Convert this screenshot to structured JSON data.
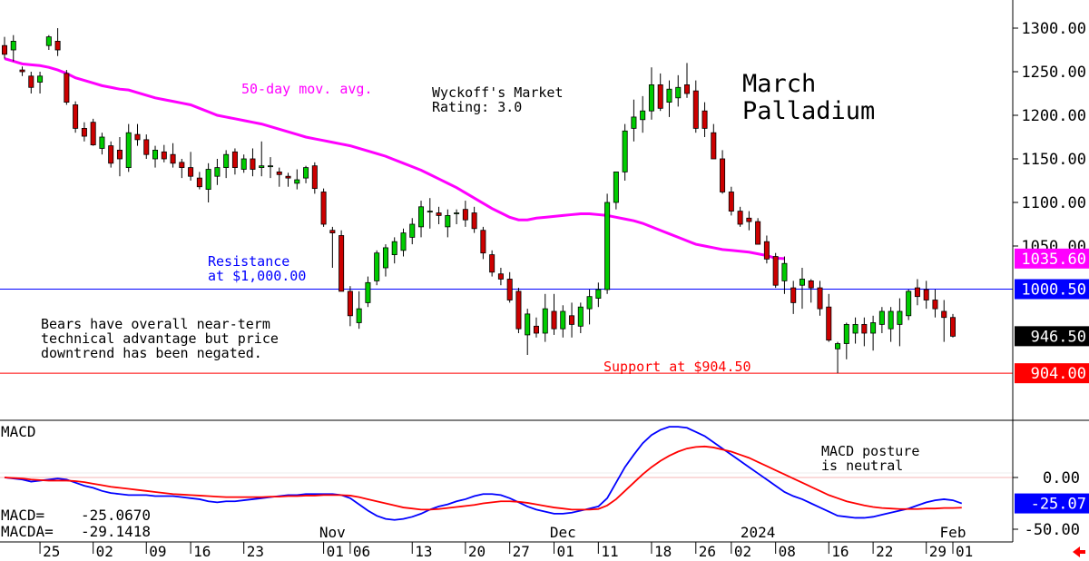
{
  "chart_data": [
    {
      "type": "candlestick",
      "title": "March\nPalladium",
      "ylim": [
        880,
        1320
      ],
      "yticks": [
        1300,
        1250,
        1200,
        1150,
        1100,
        1050
      ],
      "ytick_labels": [
        "1300.00",
        "1250.00",
        "1200.00",
        "1150.00",
        "1100.00",
        "1050.00"
      ],
      "colors": {
        "up": "#00cc00",
        "down": "#cc0000",
        "ma": "#ff00ff",
        "resistance": "#0000ff",
        "support": "#ff0000",
        "macd": "#0000ff",
        "macda": "#ff0000"
      },
      "ohlc": [
        [
          1280,
          1290,
          1265,
          1270
        ],
        [
          1275,
          1292,
          1262,
          1285
        ],
        [
          1252,
          1256,
          1245,
          1250
        ],
        [
          1245,
          1250,
          1225,
          1232
        ],
        [
          1238,
          1250,
          1225,
          1245
        ],
        [
          1280,
          1292,
          1275,
          1290
        ],
        [
          1285,
          1300,
          1268,
          1275
        ],
        [
          1248,
          1252,
          1212,
          1215
        ],
        [
          1212,
          1216,
          1180,
          1185
        ],
        [
          1185,
          1192,
          1170,
          1176
        ],
        [
          1192,
          1196,
          1165,
          1166
        ],
        [
          1162,
          1180,
          1155,
          1175
        ],
        [
          1165,
          1170,
          1140,
          1145
        ],
        [
          1160,
          1175,
          1130,
          1150
        ],
        [
          1140,
          1190,
          1135,
          1180
        ],
        [
          1178,
          1190,
          1165,
          1172
        ],
        [
          1172,
          1178,
          1150,
          1155
        ],
        [
          1150,
          1165,
          1140,
          1160
        ],
        [
          1158,
          1166,
          1146,
          1150
        ],
        [
          1155,
          1168,
          1140,
          1145
        ],
        [
          1146,
          1150,
          1128,
          1140
        ],
        [
          1140,
          1158,
          1125,
          1130
        ],
        [
          1128,
          1135,
          1115,
          1118
        ],
        [
          1115,
          1145,
          1100,
          1138
        ],
        [
          1130,
          1150,
          1120,
          1140
        ],
        [
          1140,
          1160,
          1128,
          1155
        ],
        [
          1158,
          1162,
          1132,
          1140
        ],
        [
          1138,
          1155,
          1134,
          1150
        ],
        [
          1150,
          1162,
          1130,
          1138
        ],
        [
          1140,
          1170,
          1130,
          1142
        ],
        [
          1142,
          1152,
          1128,
          1142
        ],
        [
          1135,
          1140,
          1118,
          1132
        ],
        [
          1130,
          1134,
          1118,
          1128
        ],
        [
          1122,
          1138,
          1115,
          1126
        ],
        [
          1128,
          1142,
          1122,
          1140
        ],
        [
          1142,
          1146,
          1110,
          1116
        ],
        [
          1112,
          1116,
          1072,
          1075
        ],
        [
          1068,
          1072,
          1025,
          1065
        ],
        [
          1062,
          1068,
          1000,
          998
        ],
        [
          998,
          1004,
          958,
          970
        ],
        [
          962,
          998,
          955,
          978
        ],
        [
          985,
          1015,
          980,
          1008
        ],
        [
          1010,
          1045,
          1005,
          1042
        ],
        [
          1025,
          1052,
          1015,
          1048
        ],
        [
          1040,
          1060,
          1030,
          1055
        ],
        [
          1045,
          1070,
          1038,
          1065
        ],
        [
          1060,
          1082,
          1052,
          1075
        ],
        [
          1072,
          1102,
          1060,
          1095
        ],
        [
          1090,
          1105,
          1070,
          1090
        ],
        [
          1088,
          1095,
          1075,
          1085
        ],
        [
          1072,
          1092,
          1060,
          1085
        ],
        [
          1088,
          1092,
          1075,
          1088
        ],
        [
          1092,
          1102,
          1072,
          1080
        ],
        [
          1088,
          1095,
          1065,
          1070
        ],
        [
          1068,
          1072,
          1035,
          1042
        ],
        [
          1040,
          1045,
          1015,
          1020
        ],
        [
          1018,
          1025,
          1005,
          1012
        ],
        [
          1012,
          1020,
          985,
          988
        ],
        [
          998,
          1002,
          950,
          955
        ],
        [
          948,
          978,
          925,
          972
        ],
        [
          958,
          968,
          945,
          950
        ],
        [
          950,
          995,
          940,
          978
        ],
        [
          975,
          995,
          948,
          955
        ],
        [
          955,
          982,
          945,
          975
        ],
        [
          970,
          985,
          945,
          960
        ],
        [
          958,
          985,
          950,
          980
        ],
        [
          978,
          1000,
          960,
          992
        ],
        [
          990,
          1008,
          980,
          1000
        ],
        [
          1000,
          1110,
          995,
          1100
        ],
        [
          1100,
          1135,
          1092,
          1135
        ],
        [
          1135,
          1190,
          1125,
          1182
        ],
        [
          1185,
          1218,
          1170,
          1198
        ],
        [
          1195,
          1222,
          1180,
          1205
        ],
        [
          1205,
          1255,
          1195,
          1235
        ],
        [
          1235,
          1248,
          1205,
          1208
        ],
        [
          1215,
          1240,
          1198,
          1230
        ],
        [
          1220,
          1246,
          1210,
          1232
        ],
        [
          1235,
          1260,
          1220,
          1225
        ],
        [
          1228,
          1240,
          1180,
          1185
        ],
        [
          1205,
          1215,
          1175,
          1185
        ],
        [
          1180,
          1190,
          1155,
          1150
        ],
        [
          1150,
          1160,
          1110,
          1112
        ],
        [
          1112,
          1118,
          1085,
          1090
        ],
        [
          1090,
          1095,
          1072,
          1075
        ],
        [
          1082,
          1090,
          1068,
          1078
        ],
        [
          1078,
          1082,
          1052,
          1052
        ],
        [
          1055,
          1062,
          1030,
          1035
        ],
        [
          1038,
          1042,
          1002,
          1005
        ],
        [
          1010,
          1038,
          995,
          1030
        ],
        [
          1002,
          1010,
          972,
          985
        ],
        [
          1005,
          1025,
          978,
          1012
        ],
        [
          1010,
          1012,
          985,
          1002
        ],
        [
          1002,
          1010,
          970,
          978
        ],
        [
          980,
          995,
          940,
          942
        ],
        [
          932,
          940,
          904,
          938
        ],
        [
          938,
          962,
          920,
          960
        ],
        [
          950,
          968,
          938,
          960
        ],
        [
          960,
          968,
          935,
          950
        ],
        [
          950,
          970,
          930,
          962
        ],
        [
          960,
          980,
          950,
          975
        ],
        [
          955,
          980,
          940,
          975
        ],
        [
          960,
          990,
          935,
          975
        ],
        [
          970,
          1000,
          965,
          998
        ],
        [
          1002,
          1012,
          982,
          992
        ],
        [
          1000,
          1010,
          978,
          988
        ],
        [
          988,
          1000,
          968,
          978
        ],
        [
          975,
          988,
          940,
          968
        ],
        [
          968,
          972,
          945,
          946.5
        ]
      ],
      "ma_50": [
        1265,
        1262,
        1259,
        1258,
        1257,
        1255,
        1252,
        1248,
        1243,
        1240,
        1237,
        1234,
        1232,
        1230,
        1229,
        1226,
        1223,
        1220,
        1218,
        1216,
        1214,
        1212,
        1208,
        1204,
        1200,
        1198,
        1196,
        1194,
        1192,
        1190,
        1187,
        1184,
        1181,
        1178,
        1175,
        1173,
        1171,
        1169,
        1167,
        1165,
        1162,
        1159,
        1156,
        1153,
        1149,
        1145,
        1141,
        1137,
        1132,
        1127,
        1122,
        1117,
        1111,
        1105,
        1099,
        1093,
        1088,
        1083,
        1080,
        1080,
        1082,
        1083,
        1084,
        1085,
        1086,
        1087,
        1087,
        1086,
        1085,
        1083,
        1081,
        1079,
        1076,
        1072,
        1068,
        1064,
        1060,
        1056,
        1052,
        1050,
        1048,
        1046,
        1045,
        1044,
        1043,
        1041,
        1039,
        1036,
        1035.6
      ],
      "resistance": {
        "value": 1000.5,
        "label": "Resistance\nat $1,000.00"
      },
      "support": {
        "value": 904,
        "label": "Support at $904.50"
      },
      "price_labels": [
        {
          "value": 1035.6,
          "text": "1035.60",
          "bg": "#ff00ff"
        },
        {
          "value": 1000.5,
          "text": "1000.50",
          "bg": "#0000ff"
        },
        {
          "value": 946.5,
          "text": "946.50",
          "bg": "#000000"
        },
        {
          "value": 904,
          "text": "904.00",
          "bg": "#ff0000"
        }
      ],
      "annotations": [
        {
          "id": "ma-label",
          "text": "50-day mov. avg.",
          "color": "#ff00ff"
        },
        {
          "id": "wyckoff-rating",
          "text": "Wyckoff's Market\nRating: 3.0",
          "color": "#000000"
        },
        {
          "id": "bears-note",
          "text": "Bears have overall near-term\ntechnical advantage but price\ndowntrend has been negated.",
          "color": "#000000"
        }
      ],
      "x_ticks": [
        {
          "i": 4,
          "label": "25"
        },
        {
          "i": 10,
          "label": "02"
        },
        {
          "i": 16,
          "label": "09"
        },
        {
          "i": 21,
          "label": "16"
        },
        {
          "i": 27,
          "label": "23"
        },
        {
          "i": 36,
          "label": "01"
        },
        {
          "i": 39,
          "label": "06"
        },
        {
          "i": 46,
          "label": "13"
        },
        {
          "i": 52,
          "label": "20"
        },
        {
          "i": 57,
          "label": "27"
        },
        {
          "i": 62,
          "label": "01"
        },
        {
          "i": 67,
          "label": "11"
        },
        {
          "i": 73,
          "label": "18"
        },
        {
          "i": 78,
          "label": "26"
        },
        {
          "i": 82,
          "label": "02"
        },
        {
          "i": 87,
          "label": "08"
        },
        {
          "i": 93,
          "label": "16"
        },
        {
          "i": 98,
          "label": "22"
        },
        {
          "i": 104,
          "label": "29"
        },
        {
          "i": 107,
          "label": "01"
        }
      ],
      "month_labels": [
        {
          "i": 37,
          "label": "Nov"
        },
        {
          "i": 63,
          "label": "Dec"
        },
        {
          "i": 85,
          "label": "2024"
        },
        {
          "i": 107,
          "label": "Feb"
        }
      ]
    },
    {
      "type": "line",
      "title": "MACD",
      "ylim": [
        -60,
        30
      ],
      "yticks": [
        0,
        -50
      ],
      "ytick_labels": [
        "0.00",
        "-50.00"
      ],
      "series": [
        {
          "name": "MACD",
          "color": "#0000ff",
          "values": [
            0,
            -1,
            -2,
            -4,
            -3,
            -2,
            -1,
            -2,
            -5,
            -8,
            -10,
            -13,
            -15,
            -16,
            -17,
            -17,
            -17,
            -18,
            -18,
            -18,
            -19,
            -20,
            -21,
            -23,
            -24,
            -23,
            -23,
            -22,
            -21,
            -20,
            -19,
            -18,
            -17,
            -17,
            -16,
            -16,
            -16,
            -16,
            -17,
            -20,
            -26,
            -32,
            -37,
            -40,
            -41,
            -40,
            -38,
            -35,
            -31,
            -28,
            -26,
            -23,
            -21,
            -18,
            -16,
            -16,
            -17,
            -20,
            -24,
            -28,
            -31,
            -33,
            -35,
            -35,
            -34,
            -32,
            -30,
            -28,
            -20,
            -5,
            10,
            22,
            33,
            41,
            46,
            49,
            49,
            48,
            44,
            40,
            34,
            28,
            22,
            16,
            10,
            4,
            -2,
            -8,
            -14,
            -18,
            -21,
            -25,
            -29,
            -33,
            -37,
            -38,
            -39,
            -39,
            -38,
            -36,
            -34,
            -32,
            -30,
            -27,
            -24,
            -22,
            -21,
            -22,
            -25.07
          ]
        },
        {
          "name": "MACDA",
          "color": "#ff0000",
          "values": [
            0,
            -0.5,
            -1,
            -2,
            -2.5,
            -3,
            -3,
            -3,
            -3.5,
            -4.5,
            -6,
            -7.5,
            -9,
            -10,
            -11,
            -12,
            -13,
            -14,
            -15,
            -16,
            -16.5,
            -17,
            -17.5,
            -18,
            -18.5,
            -19,
            -19,
            -19,
            -19,
            -19,
            -18.5,
            -18.5,
            -18,
            -18,
            -17.5,
            -17.5,
            -17,
            -17,
            -17,
            -17.5,
            -19,
            -21,
            -23,
            -25,
            -27,
            -29,
            -30,
            -31,
            -31,
            -30.5,
            -29.5,
            -28.5,
            -27.5,
            -26.5,
            -25,
            -24,
            -23,
            -23,
            -23.5,
            -24.5,
            -26,
            -27.5,
            -29,
            -30,
            -31,
            -31,
            -31,
            -30.5,
            -27,
            -21,
            -13,
            -5,
            3,
            10,
            16,
            21,
            25,
            28,
            29.5,
            30,
            29,
            27,
            25,
            22,
            19,
            15,
            11,
            7,
            3,
            -1,
            -5,
            -9,
            -13,
            -17,
            -20,
            -23,
            -25,
            -27,
            -28.5,
            -29.5,
            -30,
            -30.5,
            -30.5,
            -30.5,
            -30,
            -30,
            -29.5,
            -29.5,
            -29.1418
          ]
        }
      ],
      "readouts": [
        {
          "label": "MACD=",
          "value": "-25.0670"
        },
        {
          "label": "MACDA=",
          "value": "-29.1418"
        }
      ],
      "price_labels": [
        {
          "value": -25.07,
          "text": "-25.07",
          "bg": "#0000ff"
        }
      ],
      "annotation": "MACD posture\nis neutral"
    }
  ],
  "ui": {
    "scroll_arrow_icon": "left-arrow-icon"
  }
}
